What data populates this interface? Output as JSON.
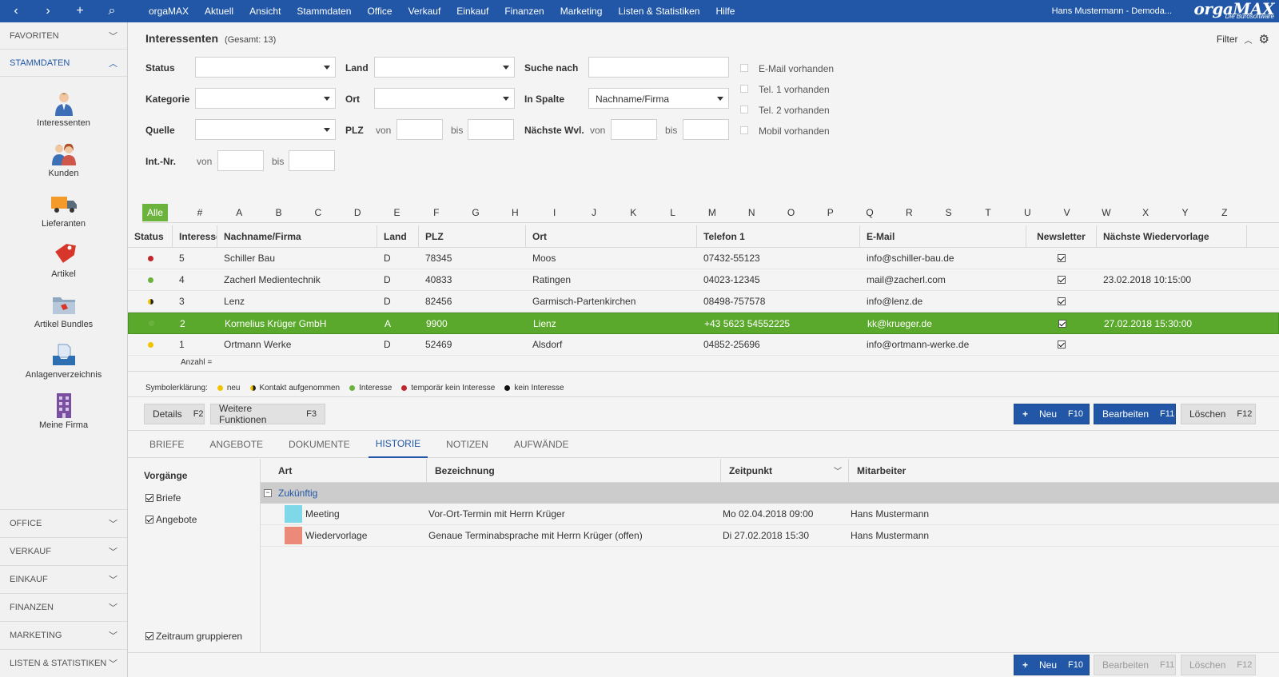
{
  "topbar": {
    "nav": [
      "‹",
      "›",
      "+",
      "⌕"
    ],
    "menu": [
      "orgaMAX",
      "Aktuell",
      "Ansicht",
      "Stammdaten",
      "Office",
      "Verkauf",
      "Einkauf",
      "Finanzen",
      "Marketing",
      "Listen & Statistiken",
      "Hilfe"
    ],
    "user": "Hans Mustermann - Demoda...",
    "brand": "orgaMAX",
    "brand_sub": "Die Bürosoftware",
    "accent": "#2157a6"
  },
  "sidebar": {
    "favoriten": "FAVORITEN",
    "stammdaten": "STAMMDATEN",
    "items": [
      {
        "label": "Interessenten",
        "icon": "person-icon"
      },
      {
        "label": "Kunden",
        "icon": "customers-icon"
      },
      {
        "label": "Lieferanten",
        "icon": "truck-icon"
      },
      {
        "label": "Artikel",
        "icon": "tag-icon"
      },
      {
        "label": "Artikel Bundles",
        "icon": "folder-icon"
      },
      {
        "label": "Anlagenverzeichnis",
        "icon": "inbox-icon"
      },
      {
        "label": "Meine Firma",
        "icon": "building-icon"
      }
    ],
    "bottom": [
      "OFFICE",
      "VERKAUF",
      "EINKAUF",
      "FINANZEN",
      "MARKETING",
      "LISTEN & STATISTIKEN"
    ]
  },
  "header": {
    "title": "Interessenten",
    "count": "(Gesamt: 13)",
    "filter": "Filter"
  },
  "filters": {
    "status": "Status",
    "land": "Land",
    "suche_nach": "Suche nach",
    "kategorie": "Kategorie",
    "ort": "Ort",
    "in_spalte": "In Spalte",
    "in_spalte_value": "Nachname/Firma",
    "quelle": "Quelle",
    "plz": "PLZ",
    "von": "von",
    "bis": "bis",
    "naechste_wvl": "Nächste Wvl.",
    "int_nr": "Int.-Nr.",
    "checks": [
      "E-Mail vorhanden",
      "Tel. 1 vorhanden",
      "Tel. 2 vorhanden",
      "Mobil vorhanden"
    ]
  },
  "alphabet": {
    "all": "Alle",
    "letters": [
      "#",
      "A",
      "B",
      "C",
      "D",
      "E",
      "F",
      "G",
      "H",
      "I",
      "J",
      "K",
      "L",
      "M",
      "N",
      "O",
      "P",
      "Q",
      "R",
      "S",
      "T",
      "U",
      "V",
      "W",
      "X",
      "Y",
      "Z"
    ]
  },
  "table": {
    "columns": [
      "Status",
      "Interesse",
      "Nachname/Firma",
      "Land",
      "PLZ",
      "Ort",
      "Telefon 1",
      "E-Mail",
      "Newsletter",
      "Nächste Wiedervorlage"
    ],
    "rows": [
      {
        "status_color": "#c0272d",
        "status_shape": "dot",
        "interesse": "5",
        "name": "Schiller Bau",
        "land": "D",
        "plz": "78345",
        "ort": "Moos",
        "tel": "07432-55123",
        "email": "info@schiller-bau.de",
        "newsletter": true,
        "wvl": ""
      },
      {
        "status_color": "#6cb33e",
        "status_shape": "dot",
        "interesse": "4",
        "name": "Zacherl Medientechnik",
        "land": "D",
        "plz": "40833",
        "ort": "Ratingen",
        "tel": "04023-12345",
        "email": "mail@zacherl.com",
        "newsletter": true,
        "wvl": "23.02.2018 10:15:00"
      },
      {
        "status_color": "#f2c400",
        "status_shape": "half",
        "interesse": "3",
        "name": "Lenz",
        "land": "D",
        "plz": "82456",
        "ort": "Garmisch-Partenkirchen",
        "tel": "08498-757578",
        "email": "info@lenz.de",
        "newsletter": true,
        "wvl": ""
      },
      {
        "status_color": "#6cb33e",
        "status_shape": "dot",
        "interesse": "2",
        "name": "Kornelius Krüger GmbH",
        "land": "A",
        "plz": "9900",
        "ort": "Lienz",
        "tel": "+43 5623 54552225",
        "email": "kk@krueger.de",
        "newsletter": true,
        "wvl": "27.02.2018 15:30:00",
        "selected": true
      },
      {
        "status_color": "#f2c400",
        "status_shape": "dot",
        "interesse": "1",
        "name": "Ortmann Werke",
        "land": "D",
        "plz": "52469",
        "ort": "Alsdorf",
        "tel": "04852-25696",
        "email": "info@ortmann-werke.de",
        "newsletter": true,
        "wvl": ""
      }
    ],
    "anzahl": "Anzahl ="
  },
  "legend": {
    "title": "Symbolerklärung:",
    "items": [
      {
        "label": "neu",
        "color": "#f2c400"
      },
      {
        "label": "Kontakt aufgenommen",
        "color": "#f2c400"
      },
      {
        "label": "Interesse",
        "color": "#6cb33e"
      },
      {
        "label": "temporär kein Interesse",
        "color": "#c0272d"
      },
      {
        "label": "kein Interesse",
        "color": "#111111"
      }
    ]
  },
  "buttons": {
    "details": "Details",
    "details_key": "F2",
    "weitere": "Weitere Funktionen",
    "weitere_key": "F3",
    "neu": "Neu",
    "neu_key": "F10",
    "bearbeiten": "Bearbeiten",
    "bearbeiten_key": "F11",
    "loeschen": "Löschen",
    "loeschen_key": "F12"
  },
  "tabs": [
    "BRIEFE",
    "ANGEBOTE",
    "DOKUMENTE",
    "HISTORIE",
    "NOTIZEN",
    "AUFWÄNDE"
  ],
  "history": {
    "vorgaenge": "Vorgänge",
    "check_briefe": "Briefe",
    "check_angebote": "Angebote",
    "zeitraum": "Zeitraum gruppieren",
    "columns": [
      "Art",
      "Bezeichnung",
      "Zeitpunkt",
      "Mitarbeiter"
    ],
    "group": "Zukünftig",
    "rows": [
      {
        "color": "#7fd8e8",
        "art": "Meeting",
        "bez": "Vor-Ort-Termin mit Herrn Krüger",
        "zeit": "Mo 02.04.2018 09:00",
        "mitarbeiter": "Hans Mustermann"
      },
      {
        "color": "#ec8a7a",
        "art": "Wiedervorlage",
        "bez": "Genaue Terminabsprache mit Herrn Krüger (offen)",
        "zeit": "Di 27.02.2018 15:30",
        "mitarbeiter": "Hans Mustermann"
      }
    ]
  }
}
